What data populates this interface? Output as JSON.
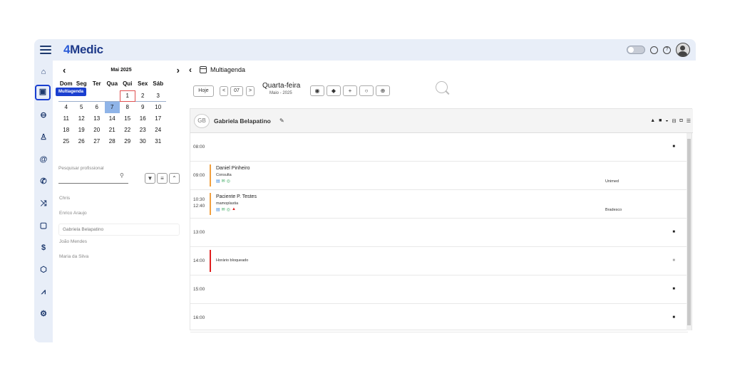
{
  "app": {
    "logo_prefix": "4",
    "logo_main": "Medic"
  },
  "nav": {
    "tooltip": "Multiagenda"
  },
  "calendar": {
    "month_label": "Mai  2025",
    "weekdays": [
      "Dom",
      "Seg",
      "Ter",
      "Qua",
      "Qui",
      "Sex",
      "Sáb"
    ],
    "weeks": [
      [
        "",
        "",
        "",
        "",
        "1",
        "2",
        "3"
      ],
      [
        "4",
        "5",
        "6",
        "7",
        "8",
        "9",
        "10"
      ],
      [
        "11",
        "12",
        "13",
        "14",
        "15",
        "16",
        "17"
      ],
      [
        "18",
        "19",
        "20",
        "21",
        "22",
        "23",
        "24"
      ],
      [
        "25",
        "26",
        "27",
        "28",
        "29",
        "30",
        "31"
      ]
    ],
    "today": "1",
    "selected": "7"
  },
  "search": {
    "label": "Pesquisar profissional"
  },
  "professionals": [
    "Chris",
    "Enrico Araujo",
    "Gabriela Belapatino",
    "João Mendes",
    "Maria da Silva"
  ],
  "selected_professional": "Gabriela Belapatino",
  "header": {
    "title": "Multiagenda"
  },
  "toolbar": {
    "today_label": "Hoje",
    "prev": "<",
    "date": "07",
    "next": ">",
    "day_name": "Quarta-feira",
    "month_year": "Maio - 2025",
    "add": "+"
  },
  "schedule": {
    "initials": "GB",
    "professional": "Gabriela Belapatino",
    "slots": [
      {
        "time": "08:00",
        "lock": true
      },
      {
        "time": "09:00",
        "patient": "Daniel Pinheiro",
        "procedure": "Consulta",
        "insurance": "Unimed",
        "color": "#f0a040"
      },
      {
        "time": "10:30",
        "time_end": "12:40",
        "patient": "Paciente P. Testes",
        "procedure": "mamoplastia",
        "insurance": "Bradesco",
        "color": "#f0a040",
        "warning": true
      },
      {
        "time": "13:00",
        "lock": true
      },
      {
        "time": "14:00",
        "blocked_label": "Horário bloqueado",
        "color": "#e02020",
        "lock_gray": true
      },
      {
        "time": "15:00",
        "lock": true
      },
      {
        "time": "16:00",
        "lock": true
      }
    ]
  }
}
